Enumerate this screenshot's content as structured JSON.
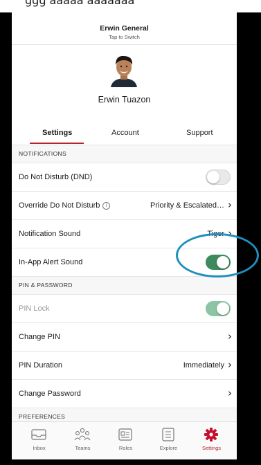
{
  "header": {
    "org_name": "Erwin General",
    "switch_hint": "Tap to Switch"
  },
  "profile": {
    "name": "Erwin Tuazon"
  },
  "tabs": [
    {
      "label": "Settings",
      "active": true
    },
    {
      "label": "Account"
    },
    {
      "label": "Support"
    }
  ],
  "sections": {
    "notifications": {
      "title": "NOTIFICATIONS",
      "dnd": {
        "label": "Do Not Disturb (DND)",
        "enabled": false
      },
      "override": {
        "label": "Override Do Not Disturb",
        "value": "Priority & Escalated…"
      },
      "sound": {
        "label": "Notification Sound",
        "value": "Tiger"
      },
      "inapp": {
        "label": "In-App Alert Sound",
        "enabled": true
      }
    },
    "pin": {
      "title": "PIN & PASSWORD",
      "lock": {
        "label": "PIN Lock",
        "enabled": true,
        "disabled": true
      },
      "change_pin": {
        "label": "Change PIN"
      },
      "duration": {
        "label": "PIN Duration",
        "value": "Immediately"
      },
      "change_password": {
        "label": "Change Password"
      }
    },
    "preferences": {
      "title": "PREFERENCES"
    }
  },
  "tabbar": {
    "items": [
      {
        "label": "Inbox",
        "icon": "inbox-icon"
      },
      {
        "label": "Teams",
        "icon": "teams-icon"
      },
      {
        "label": "Roles",
        "icon": "roles-icon"
      },
      {
        "label": "Explore",
        "icon": "explore-icon"
      },
      {
        "label": "Settings",
        "icon": "gear-icon",
        "active": true
      }
    ]
  },
  "colors": {
    "accent": "#b3262b",
    "toggle_on": "#3d8a5e",
    "annotation": "#1f8fbd"
  }
}
